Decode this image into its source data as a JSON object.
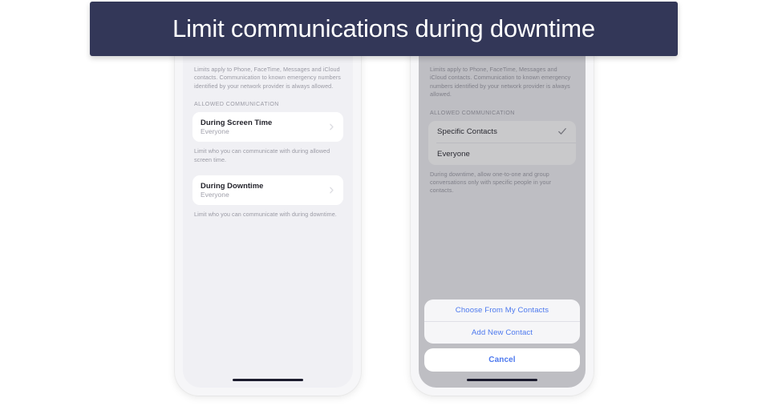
{
  "banner": {
    "title": "Limit communications during downtime",
    "background_color": "#333758",
    "text_color": "#ffffff"
  },
  "accent_color": "#4d79ee",
  "phones": {
    "left": {
      "name": "communication-limits-settings",
      "footnote_top": "Limits apply to Phone, FaceTime, Messages and iCloud contacts. Communication to known emergency numbers identified by your network provider is always allowed.",
      "section_header": "ALLOWED COMMUNICATION",
      "rows": [
        {
          "title": "During Screen Time",
          "subtitle": "Everyone",
          "accessory": "chevron-right-icon",
          "footnote": "Limit who you can communicate with during allowed screen time."
        },
        {
          "title": "During Downtime",
          "subtitle": "Everyone",
          "accessory": "chevron-right-icon",
          "footnote": "Limit who you can communicate with during downtime."
        }
      ]
    },
    "right": {
      "name": "during-downtime-options-with-action-sheet",
      "footnote_top": "Limits apply to Phone, FaceTime, Messages and iCloud contacts. Communication to known emergency numbers identified by your network provider is always allowed.",
      "section_header": "ALLOWED COMMUNICATION",
      "options": [
        {
          "label": "Specific Contacts",
          "selected": true
        },
        {
          "label": "Everyone",
          "selected": false
        }
      ],
      "footnote_bottom": "During downtime, allow one-to-one and group conversations only with specific people in your contacts.",
      "action_sheet": {
        "buttons": [
          "Choose From My Contacts",
          "Add New Contact"
        ],
        "cancel": "Cancel"
      }
    }
  }
}
